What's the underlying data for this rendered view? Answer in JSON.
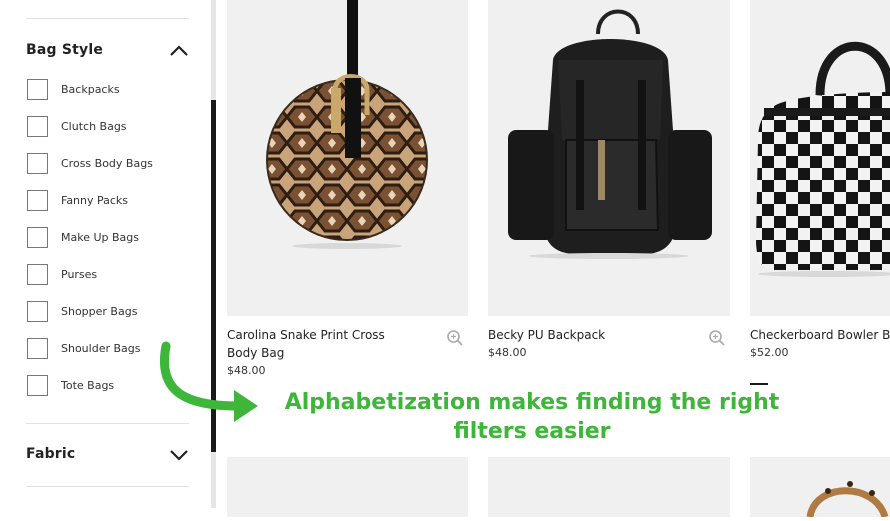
{
  "sidebar": {
    "bag_style": {
      "title": "Bag Style",
      "options": [
        {
          "label": "Backpacks"
        },
        {
          "label": "Clutch Bags"
        },
        {
          "label": "Cross Body Bags"
        },
        {
          "label": "Fanny Packs"
        },
        {
          "label": "Make Up Bags"
        },
        {
          "label": "Purses"
        },
        {
          "label": "Shopper Bags"
        },
        {
          "label": "Shoulder Bags"
        },
        {
          "label": "Tote Bags"
        }
      ]
    },
    "fabric": {
      "title": "Fabric"
    }
  },
  "products": [
    {
      "name_line1": "Carolina Snake Print Cross",
      "name_line2": "Body Bag",
      "price": "$48.00"
    },
    {
      "name_line1": "Becky PU Backpack",
      "name_line2": "",
      "price": "$48.00"
    },
    {
      "name_line1": "Checkerboard Bowler Ba",
      "name_line2": "",
      "price": "$52.00"
    }
  ],
  "annotation": {
    "line1": "Alphabetization makes finding the right",
    "line2": "filters easier"
  },
  "colors": {
    "accent": "#3db63a",
    "background": "#ffffff",
    "image_bg": "#f0f0f0"
  },
  "icons": [
    "chevron-up-icon",
    "chevron-down-icon",
    "zoom-icon"
  ]
}
